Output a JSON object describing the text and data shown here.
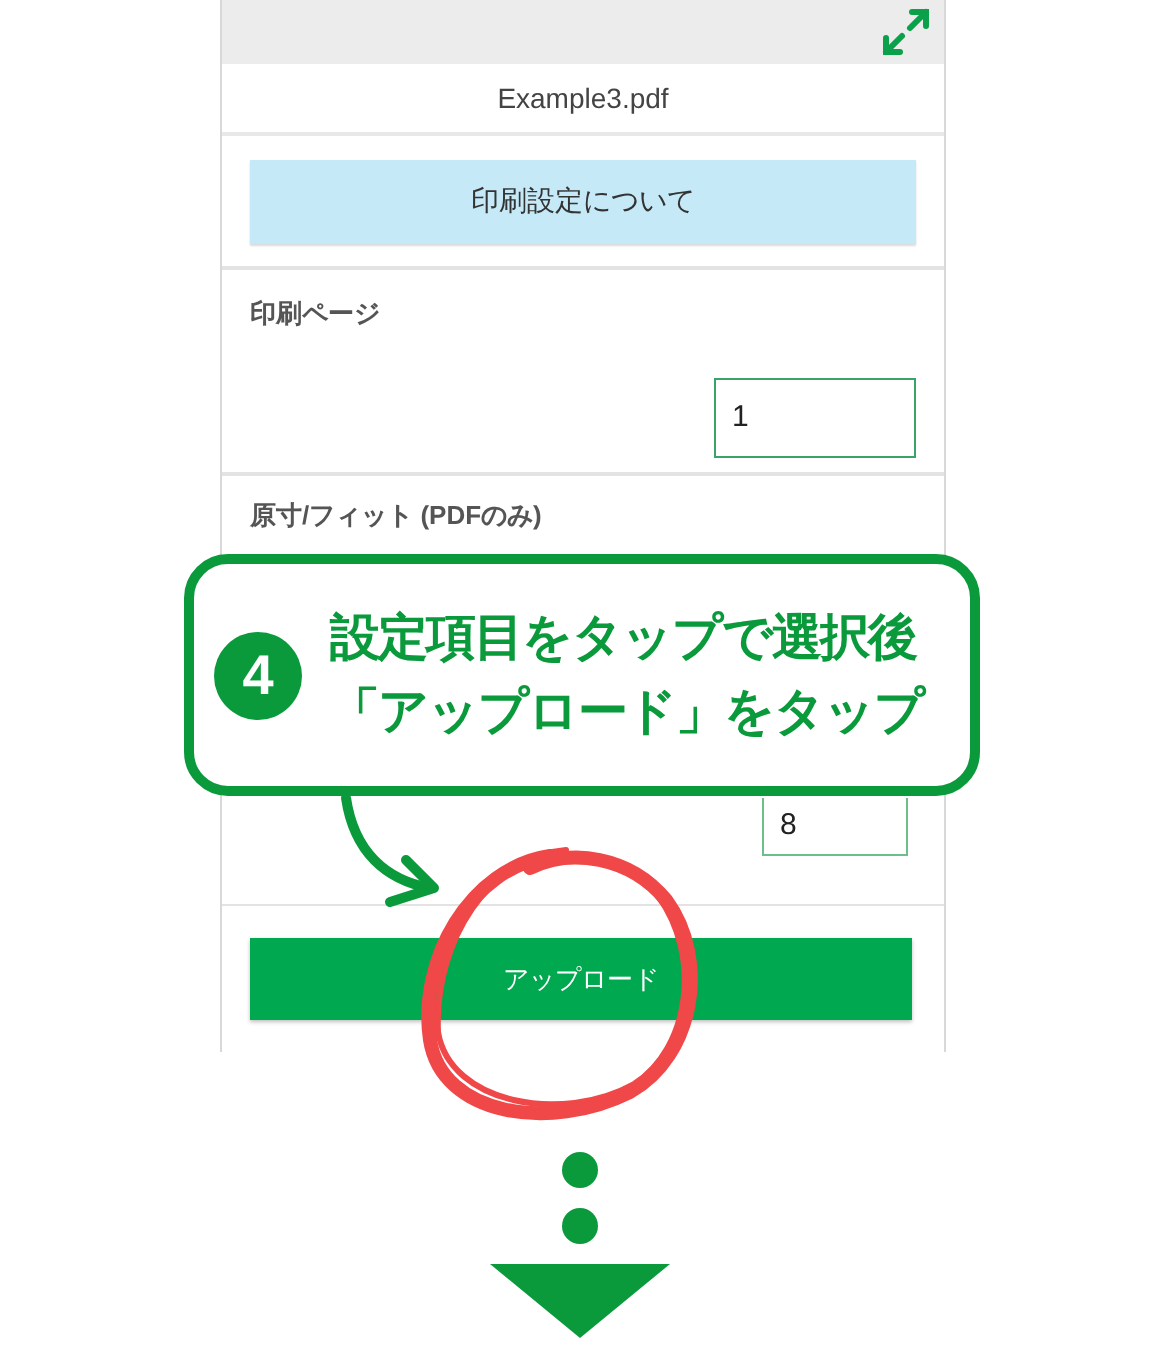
{
  "file_name": "Example3.pdf",
  "info_button": "印刷設定について",
  "sections": [
    {
      "label": "印刷ページ",
      "value": "1"
    },
    {
      "label": "原寸/フィット (PDFのみ)",
      "value": "8"
    }
  ],
  "upload_button": "アップロード",
  "callout": {
    "step": "4",
    "lines": [
      "設定項目をタップで選択後",
      "「アップロード」をタップ"
    ]
  }
}
